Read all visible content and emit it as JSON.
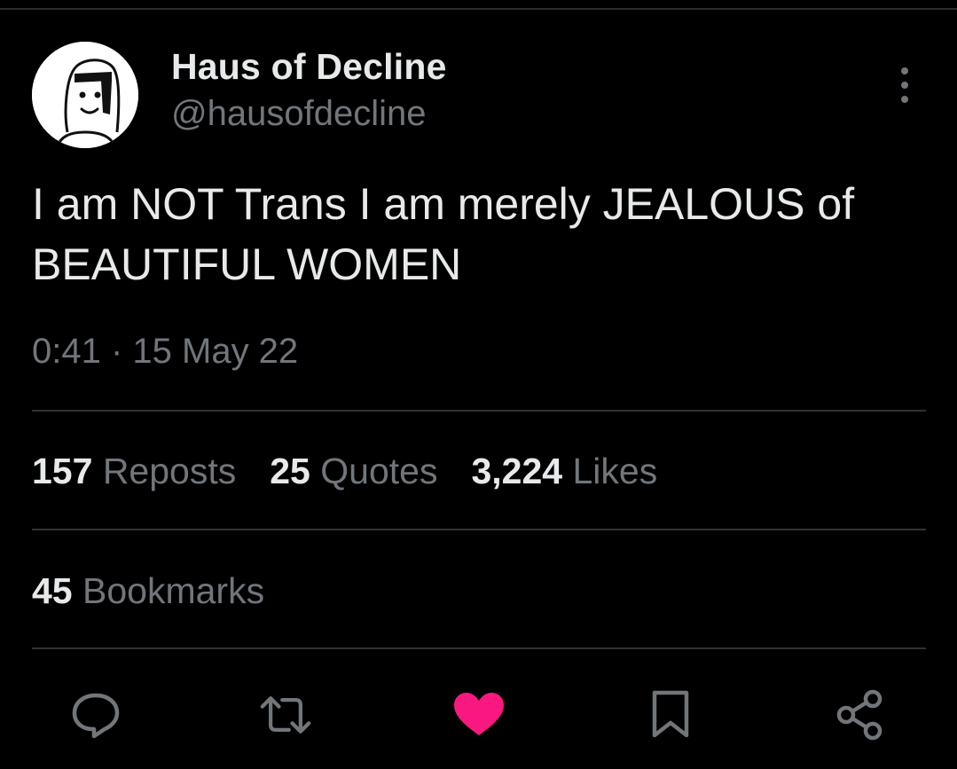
{
  "author": {
    "display_name": "Haus of Decline",
    "handle": "@hausofdecline",
    "avatar_icon": "cartoon-face-avatar"
  },
  "tweet": {
    "text": "I am NOT Trans I am merely JEALOUS of BEAUTIFUL WOMEN",
    "timestamp": "0:41 · 15 May 22"
  },
  "stats": {
    "reposts_count": "157",
    "reposts_label": "Reposts",
    "quotes_count": "25",
    "quotes_label": "Quotes",
    "likes_count": "3,224",
    "likes_label": "Likes",
    "bookmarks_count": "45",
    "bookmarks_label": "Bookmarks"
  },
  "actions": {
    "reply_icon": "reply-icon",
    "repost_icon": "repost-icon",
    "like_icon": "heart-icon",
    "bookmark_icon": "bookmark-icon",
    "share_icon": "share-icon",
    "more_icon": "more-vertical-icon"
  },
  "colors": {
    "background": "#000000",
    "primary_text": "#e7e9ea",
    "secondary_text": "#71767b",
    "divider": "#2f3336",
    "like_active": "#f91880"
  }
}
